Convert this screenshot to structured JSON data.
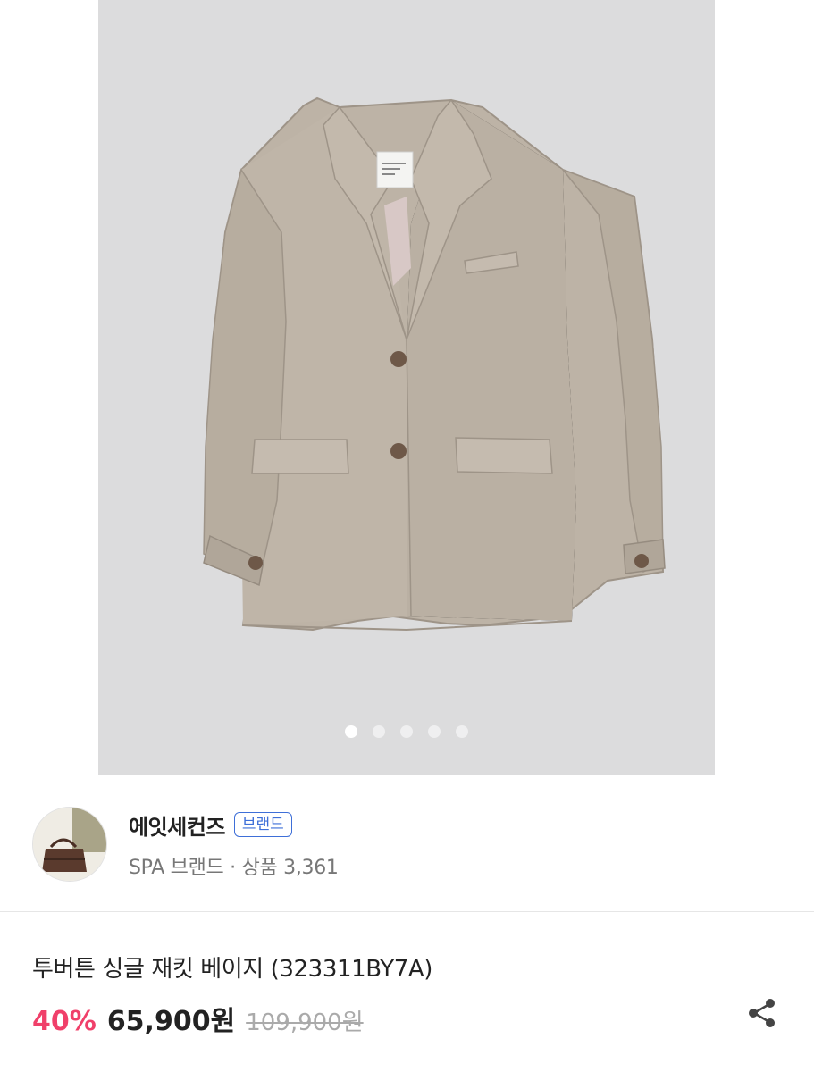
{
  "gallery": {
    "image_alt": "beige two-button single-breasted jacket",
    "slide_count": 5,
    "active_index": 0,
    "colors": {
      "background": "#dcdcdd",
      "jacket": "#bdb3a6",
      "lining": "#d8c8c6",
      "button": "#6e5848"
    }
  },
  "brand": {
    "name": "에잇세컨즈",
    "badge": "브랜드",
    "meta": "SPA 브랜드 · 상품 3,361",
    "avatar_icon": "handbag-icon"
  },
  "product": {
    "title": "투버튼 싱글 재킷 베이지 (323311BY7A)",
    "discount": "40%",
    "sale_price": "65,900원",
    "original_price": "109,900원"
  },
  "actions": {
    "share_icon": "share-icon"
  },
  "colors": {
    "discount": "#f0406a",
    "badge": "#3e6fd8"
  }
}
